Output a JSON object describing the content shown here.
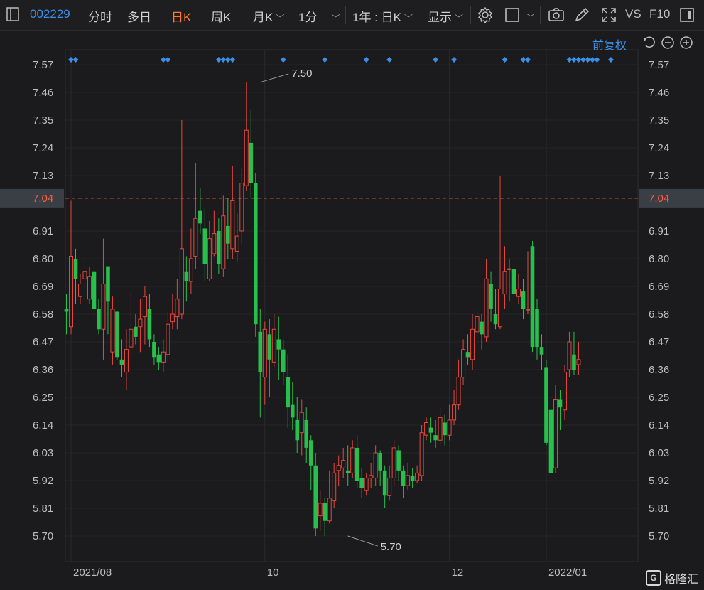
{
  "toolbar": {
    "code": "002229",
    "tab_fenshi": "分时",
    "tab_duori": "多日",
    "tab_rik": "日K",
    "tab_zhouk": "周K",
    "tab_yuek": "月K",
    "tab_1fen": "1分",
    "range_select": "1年 : 日K",
    "display_select": "显示",
    "vs_label": "VS",
    "f10_label": "F10"
  },
  "adjust_label": "前复权",
  "watermark": "格隆汇",
  "colors": {
    "up": "#e8473e",
    "down": "#28c04c",
    "background": "#1b1b1d",
    "grid": "#2a2a2c",
    "accent": "#3a8fe8",
    "current": "#ff5a3c"
  },
  "chart_data": {
    "type": "candlestick",
    "y_ticks": [
      "7.57",
      "7.46",
      "7.35",
      "7.24",
      "7.13",
      "6.91",
      "6.80",
      "6.69",
      "6.58",
      "6.47",
      "6.36",
      "6.25",
      "6.14",
      "6.03",
      "5.92",
      "5.81",
      "5.70"
    ],
    "ylim": [
      5.65,
      7.62
    ],
    "current_price": "7.04",
    "x_labels": [
      {
        "label": "2021/08",
        "index": 1
      },
      {
        "label": "10",
        "index": 43
      },
      {
        "label": "12",
        "index": 83
      },
      {
        "label": "2022/01",
        "index": 104
      }
    ],
    "max_annotation": {
      "label": "7.50",
      "index": 42,
      "value": 7.5
    },
    "min_annotation": {
      "label": "5.70",
      "index": 61,
      "value": 5.7
    },
    "markers": [
      1,
      2,
      21,
      22,
      33,
      34,
      35,
      36,
      47,
      56,
      65,
      70,
      80,
      84,
      95,
      99,
      100,
      109,
      110,
      111,
      112,
      113,
      114,
      115,
      118
    ],
    "candles": [
      [
        6.6,
        6.59,
        6.66,
        6.5
      ],
      [
        6.53,
        6.81,
        7.03,
        6.5
      ],
      [
        6.8,
        6.72,
        6.84,
        6.62
      ],
      [
        6.65,
        6.7,
        6.74,
        6.62
      ],
      [
        6.72,
        6.75,
        6.81,
        6.63
      ],
      [
        6.64,
        6.73,
        6.77,
        6.62
      ],
      [
        6.75,
        6.6,
        6.77,
        6.56
      ],
      [
        6.6,
        6.52,
        6.64,
        6.5
      ],
      [
        6.52,
        6.7,
        6.88,
        6.4
      ],
      [
        6.77,
        6.63,
        6.77,
        6.5
      ],
      [
        6.43,
        6.6,
        6.65,
        6.38
      ],
      [
        6.59,
        6.41,
        6.59,
        6.4
      ],
      [
        6.4,
        6.38,
        6.48,
        6.33
      ],
      [
        6.35,
        6.44,
        6.52,
        6.28
      ],
      [
        6.45,
        6.52,
        6.67,
        6.42
      ],
      [
        6.53,
        6.49,
        6.58,
        6.46
      ],
      [
        6.53,
        6.56,
        6.64,
        6.43
      ],
      [
        6.57,
        6.65,
        6.69,
        6.46
      ],
      [
        6.6,
        6.48,
        6.66,
        6.45
      ],
      [
        6.47,
        6.41,
        6.5,
        6.38
      ],
      [
        6.42,
        6.39,
        6.45,
        6.36
      ],
      [
        6.39,
        6.43,
        6.48,
        6.35
      ],
      [
        6.42,
        6.54,
        6.59,
        6.39
      ],
      [
        6.55,
        6.58,
        6.66,
        6.52
      ],
      [
        6.57,
        6.64,
        6.72,
        6.52
      ],
      [
        6.58,
        6.84,
        7.35,
        6.56
      ],
      [
        6.75,
        6.71,
        6.81,
        6.63
      ],
      [
        6.71,
        6.8,
        6.92,
        6.66
      ],
      [
        6.81,
        6.96,
        7.18,
        6.76
      ],
      [
        6.99,
        6.94,
        7.08,
        6.9
      ],
      [
        6.92,
        6.78,
        7.0,
        6.71
      ],
      [
        6.72,
        6.88,
        6.95,
        6.71
      ],
      [
        6.82,
        6.9,
        6.99,
        6.81
      ],
      [
        6.91,
        6.78,
        6.96,
        6.74
      ],
      [
        6.76,
        6.97,
        7.05,
        6.73
      ],
      [
        6.93,
        6.86,
        7.04,
        6.8
      ],
      [
        6.84,
        7.03,
        7.17,
        6.8
      ],
      [
        6.83,
        6.89,
        6.98,
        6.79
      ],
      [
        6.91,
        7.1,
        7.16,
        6.86
      ],
      [
        7.09,
        7.31,
        7.5,
        7.07
      ],
      [
        7.26,
        7.1,
        7.39,
        7.04
      ],
      [
        7.1,
        6.54,
        7.14,
        6.49
      ],
      [
        6.51,
        6.35,
        6.6,
        6.17
      ],
      [
        6.33,
        6.52,
        6.55,
        6.22
      ],
      [
        6.5,
        6.4,
        6.56,
        6.25
      ],
      [
        6.39,
        6.52,
        6.58,
        6.37
      ],
      [
        6.48,
        6.44,
        6.57,
        6.32
      ],
      [
        6.44,
        6.35,
        6.48,
        6.3
      ],
      [
        6.33,
        6.21,
        6.42,
        6.13
      ],
      [
        6.22,
        6.17,
        6.31,
        6.12
      ],
      [
        6.16,
        6.08,
        6.25,
        6.03
      ],
      [
        6.11,
        6.19,
        6.24,
        6.02
      ],
      [
        6.16,
        6.05,
        6.21,
        5.99
      ],
      [
        6.08,
        5.98,
        6.1,
        5.88
      ],
      [
        5.98,
        5.73,
        6.03,
        5.7
      ],
      [
        5.78,
        5.83,
        5.88,
        5.72
      ],
      [
        5.83,
        5.76,
        5.85,
        5.7
      ],
      [
        5.76,
        5.85,
        5.96,
        5.75
      ],
      [
        5.84,
        5.95,
        5.99,
        5.81
      ],
      [
        5.96,
        5.98,
        6.02,
        5.9
      ],
      [
        5.97,
        6.0,
        6.05,
        5.93
      ],
      [
        5.96,
        5.95,
        6.06,
        5.9
      ],
      [
        5.95,
        6.05,
        6.08,
        5.93
      ],
      [
        6.05,
        5.92,
        6.1,
        5.89
      ],
      [
        5.93,
        5.89,
        5.97,
        5.85
      ],
      [
        5.88,
        5.93,
        5.95,
        5.86
      ],
      [
        5.93,
        5.94,
        5.99,
        5.89
      ],
      [
        5.93,
        6.03,
        6.06,
        5.9
      ],
      [
        6.03,
        5.96,
        6.04,
        5.9
      ],
      [
        5.96,
        5.86,
        5.98,
        5.81
      ],
      [
        5.86,
        5.93,
        5.98,
        5.84
      ],
      [
        5.93,
        6.05,
        6.08,
        5.9
      ],
      [
        6.04,
        5.96,
        6.06,
        5.92
      ],
      [
        5.96,
        5.9,
        5.98,
        5.85
      ],
      [
        5.9,
        5.94,
        5.99,
        5.88
      ],
      [
        5.94,
        5.92,
        5.97,
        5.89
      ],
      [
        5.92,
        5.95,
        5.98,
        5.91
      ],
      [
        5.94,
        6.11,
        6.14,
        5.92
      ],
      [
        6.1,
        6.15,
        6.17,
        6.08
      ],
      [
        6.13,
        6.11,
        6.17,
        6.07
      ],
      [
        6.1,
        6.08,
        6.16,
        6.05
      ],
      [
        6.08,
        6.17,
        6.21,
        6.06
      ],
      [
        6.15,
        6.1,
        6.18,
        6.06
      ],
      [
        6.1,
        6.16,
        6.22,
        6.08
      ],
      [
        6.16,
        6.22,
        6.28,
        6.14
      ],
      [
        6.22,
        6.33,
        6.4,
        6.2
      ],
      [
        6.33,
        6.44,
        6.48,
        6.3
      ],
      [
        6.43,
        6.41,
        6.5,
        6.38
      ],
      [
        6.4,
        6.52,
        6.58,
        6.36
      ],
      [
        6.51,
        6.57,
        6.6,
        6.48
      ],
      [
        6.55,
        6.5,
        6.58,
        6.44
      ],
      [
        6.49,
        6.72,
        6.8,
        6.47
      ],
      [
        6.7,
        6.6,
        6.75,
        6.55
      ],
      [
        6.58,
        6.54,
        6.68,
        6.52
      ],
      [
        6.53,
        6.68,
        7.13,
        6.52
      ],
      [
        6.66,
        6.75,
        6.85,
        6.6
      ],
      [
        6.76,
        6.76,
        6.8,
        6.63
      ],
      [
        6.76,
        6.66,
        6.79,
        6.6
      ],
      [
        6.65,
        6.68,
        6.74,
        6.62
      ],
      [
        6.67,
        6.6,
        6.72,
        6.56
      ],
      [
        6.6,
        6.6,
        6.83,
        6.58
      ],
      [
        6.85,
        6.45,
        6.87,
        6.43
      ],
      [
        6.6,
        6.45,
        6.64,
        6.4
      ],
      [
        6.45,
        6.42,
        6.5,
        6.36
      ],
      [
        6.37,
        6.07,
        6.4,
        6.06
      ],
      [
        6.2,
        5.95,
        6.25,
        5.94
      ],
      [
        5.97,
        6.24,
        6.3,
        5.95
      ],
      [
        6.24,
        6.21,
        6.28,
        6.12
      ],
      [
        6.2,
        6.35,
        6.38,
        6.16
      ],
      [
        6.36,
        6.47,
        6.51,
        6.33
      ],
      [
        6.42,
        6.36,
        6.51,
        6.34
      ],
      [
        6.38,
        6.4,
        6.47,
        6.34
      ]
    ]
  }
}
